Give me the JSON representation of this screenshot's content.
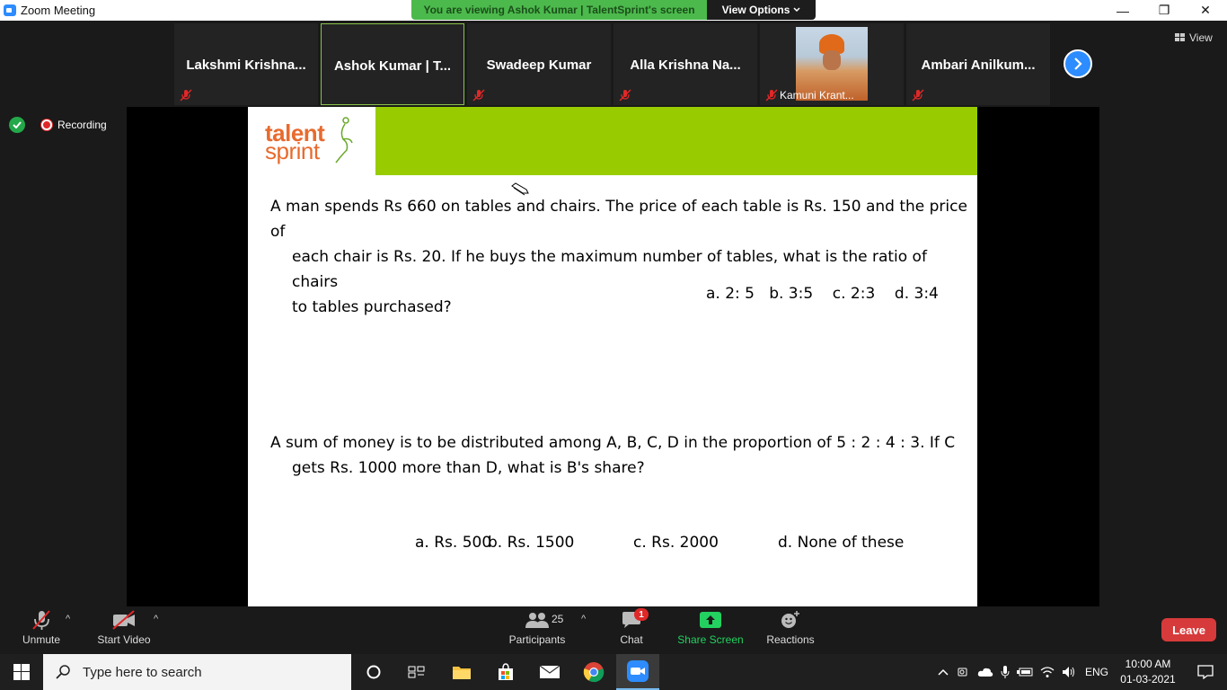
{
  "window": {
    "title": "Zoom Meeting",
    "minimize": "—",
    "restore": "❐",
    "close": "✕"
  },
  "share_banner": {
    "text": "You are viewing Ashok Kumar | TalentSprint's screen",
    "view_options": "View Options"
  },
  "gallery": {
    "participants": [
      {
        "name": "Lakshmi  Krishna...",
        "muted": true
      },
      {
        "name": "Ashok Kumar | T...",
        "muted": false,
        "active": true
      },
      {
        "name": "Swadeep Kumar",
        "muted": true
      },
      {
        "name": "Alla  Krishna  Na...",
        "muted": true
      },
      {
        "name": "Kamuni Krant...",
        "muted": true,
        "has_photo": true
      },
      {
        "name": "Ambari  Anilkum...",
        "muted": true
      }
    ],
    "view_label": "View"
  },
  "recording": {
    "label": "Recording"
  },
  "slide": {
    "logo_line1": "talent",
    "logo_line2": "sprint",
    "q1_line1": "A man spends Rs 660 on tables and chairs. The price of each table is Rs. 150 and the price of",
    "q1_line2": "each chair is Rs. 20. If he buys the maximum number of tables, what is the ratio of chairs",
    "q1_line3": "to tables purchased?",
    "q1_options": "a. 2: 5   b. 3:5    c. 2:3    d. 3:4",
    "q2_line1": "A sum of money is to be distributed among A, B, C, D in the proportion of 5 : 2 : 4 : 3. If C",
    "q2_line2": "gets Rs. 1000 more than D, what is B's share?",
    "q2_opt_a": "a. Rs. 500",
    "q2_opt_b": "b. Rs. 1500",
    "q2_opt_c": "c. Rs. 2000",
    "q2_opt_d": "d. None of these"
  },
  "controls": {
    "unmute": "Unmute",
    "start_video": "Start Video",
    "participants": "Participants",
    "participants_count": "25",
    "chat": "Chat",
    "chat_badge": "1",
    "share_screen": "Share Screen",
    "reactions": "Reactions",
    "leave": "Leave",
    "caret": "^"
  },
  "taskbar": {
    "search_placeholder": "Type here to search",
    "language": "ENG",
    "time": "10:00 AM",
    "date": "01-03-2021"
  }
}
